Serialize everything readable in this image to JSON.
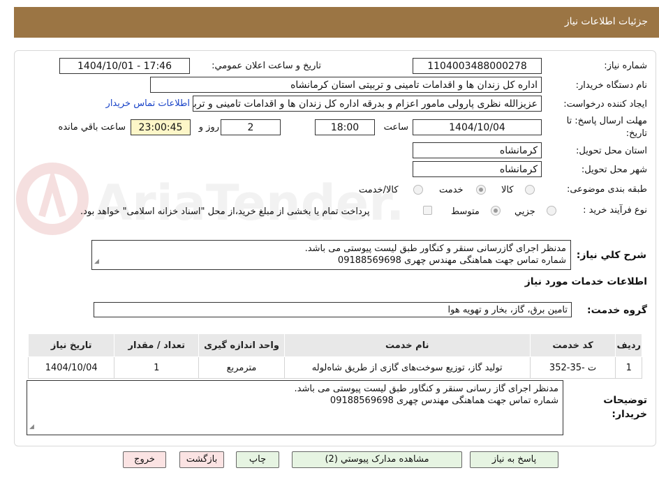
{
  "header": {
    "title": "جزئیات اطلاعات نیاز"
  },
  "form": {
    "need_number_label": "شماره نیاز:",
    "need_number": "1104003488000278",
    "announce_label": "تاریخ و ساعت اعلان عمومي:",
    "announce_value": "1404/10/01 - 17:46",
    "buyer_org_label": "نام دستگاه خريدار:",
    "buyer_org": "اداره کل زندان ها و اقدامات تامینی و تربیتی استان کرمانشاه",
    "requester_label": "ایجاد کننده درخواست:",
    "requester": "عزيزالله نظری پارولی مامور اعزام و بدرقه اداره کل زندان ها و اقدامات تامینی و تربیتی",
    "contact_link": "اطلاعات تماس خریدار",
    "deadline_label_1": "مهلت ارسال پاسخ: تا",
    "deadline_label_2": "تاریخ:",
    "deadline_date": "1404/10/04",
    "time_label": "ساعت",
    "deadline_time": "18:00",
    "days_value": "2",
    "days_label": "روز و",
    "remaining_value": "23:00:45",
    "remaining_label": "ساعت باقي مانده",
    "province_label": "استان محل تحویل:",
    "province": "کرمانشاه",
    "city_label": "شهر محل تحویل:",
    "city": "کرمانشاه",
    "category_label": "طبقه بندی موضوعی:",
    "category_options": [
      "کالا",
      "خدمت",
      "کالا/خدمت"
    ],
    "process_label": "نوع فرآیند خرید :",
    "process_options": [
      "جزيي",
      "متوسط"
    ],
    "payment_note": "پرداخت تمام یا بخشی از مبلغ خرید،از محل \"اسناد خزانه اسلامی\" خواهد بود."
  },
  "summary": {
    "label": "شرح کلي نياز:",
    "line1": "مدنظر اجرای گازرسانی سنقر و کنگاور طبق لیست پیوستی می باشد.",
    "line2": "شماره تماس جهت هماهنگی مهندس چهری 09188569698"
  },
  "services_title": "اطلاعات خدمات مورد نياز",
  "service_group": {
    "label": "گروه خدمت:",
    "value": "تامین برق، گاز، بخار و تهویه هوا"
  },
  "table": {
    "headers": [
      "رديف",
      "کد خدمت",
      "نام خدمت",
      "واحد اندازه گيری",
      "تعداد / مقدار",
      "تاريخ نياز"
    ],
    "rows": [
      [
        "1",
        "ت -35-352",
        "تولید گاز، توزیع سوخت‌های گازی از طریق شاه‌لوله",
        "مترمربع",
        "1",
        "1404/10/04"
      ]
    ]
  },
  "buyer_notes": {
    "label_1": "توضیحات",
    "label_2": "خریدار:",
    "line1": "مدنظر اجرای گاز رسانی سنقر و کنگاور طبق لیست پیوستی می باشد.",
    "line2": "شماره تماس جهت هماهنگی مهندس چهری 09188569698"
  },
  "buttons": {
    "reply": "پاسخ به نیاز",
    "attachments": "مشاهده مدارک پیوستي (2)",
    "print": "چاپ",
    "back": "بازگشت",
    "exit": "خروج"
  },
  "watermark": {
    "text": "AriaTender.neT"
  }
}
